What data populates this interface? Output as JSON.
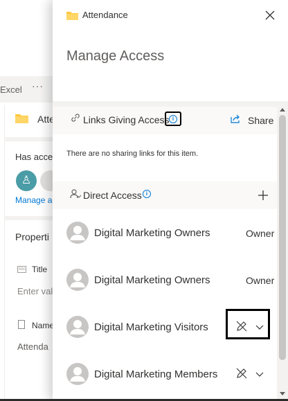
{
  "background": {
    "command_bar": {
      "excel_label": "Excel",
      "more_label": "···"
    },
    "details": {
      "item_name": "Atte",
      "has_access_label": "Has acce",
      "avatar_glyph": "♙",
      "manage_link": "Manage ac",
      "properties_heading": "Properti",
      "title_field_label": "Title",
      "title_placeholder": "Enter val",
      "name_field_label": "Name",
      "name_value": "Attenda"
    }
  },
  "panel": {
    "header": {
      "folder_title": "Attendance",
      "close_icon": "close-icon"
    },
    "heading": "Manage Access",
    "links_section": {
      "label": "Links Giving Access",
      "info_glyph": "i",
      "share_label": "Share",
      "empty_message": "There are no sharing links for this item."
    },
    "direct_section": {
      "label": "Direct Access",
      "info_glyph": "i",
      "add_glyph": "+"
    },
    "people": [
      {
        "name": "Digital Marketing Owners",
        "role": "Owner",
        "editable": false
      },
      {
        "name": "Digital Marketing Owners",
        "role": "Owner",
        "editable": false
      },
      {
        "name": "Digital Marketing Visitors",
        "role": "",
        "editable": true,
        "highlighted": true
      },
      {
        "name": "Digital Marketing Members",
        "role": "",
        "editable": true,
        "highlighted": false
      }
    ]
  },
  "colors": {
    "accent": "#0078d4",
    "folder": "#ffc83d",
    "avatar_teal": "#4a9ca6",
    "section_bg": "#faf9f8"
  }
}
